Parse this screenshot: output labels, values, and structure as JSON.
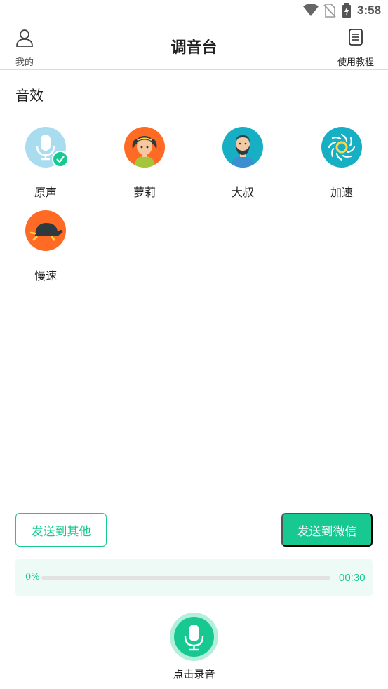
{
  "status_bar": {
    "time": "3:58"
  },
  "header": {
    "title": "调音台",
    "left_label": "我的",
    "right_label": "使用教程"
  },
  "section_title": "音效",
  "effects": [
    {
      "label": "原声",
      "icon": "microphone-icon",
      "color": "#a9dcef",
      "selected": true
    },
    {
      "label": "萝莉",
      "icon": "girl-avatar-icon",
      "color": "#ff6a25",
      "selected": false
    },
    {
      "label": "大叔",
      "icon": "bearded-man-avatar-icon",
      "color": "#17afc3",
      "selected": false
    },
    {
      "label": "加速",
      "icon": "speed-swirl-icon",
      "color": "#17afc3",
      "selected": false
    },
    {
      "label": "慢速",
      "icon": "turtle-icon",
      "color": "#ff6a25",
      "selected": false
    }
  ],
  "buttons": {
    "send_other": "发送到其他",
    "send_wechat": "发送到微信"
  },
  "progress": {
    "percent_label": "0%",
    "value": 0,
    "duration": "00:30"
  },
  "record": {
    "label": "点击录音"
  },
  "colors": {
    "accent": "#17c990",
    "accent_light": "#b5efdc",
    "panel_bg": "#eefaf6"
  }
}
